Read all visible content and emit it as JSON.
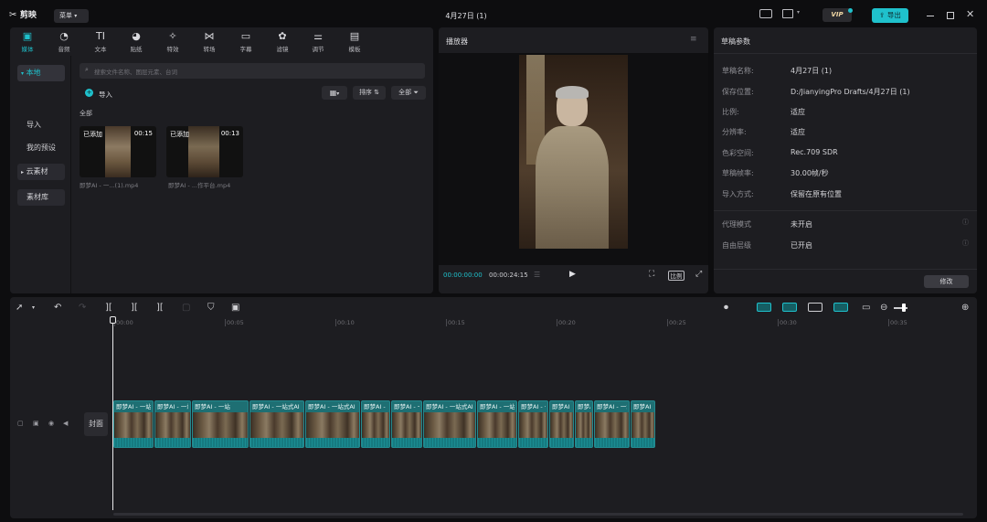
{
  "app": {
    "logo_text": "剪映",
    "menu_label": "菜单",
    "title": "4月27日 (1)",
    "vip_label": "VIP",
    "export_label": "导出"
  },
  "toolbar": {
    "items": [
      {
        "label": "媒体",
        "icon": "media-icon"
      },
      {
        "label": "音频",
        "icon": "audio-icon"
      },
      {
        "label": "文本",
        "icon": "text-icon"
      },
      {
        "label": "贴纸",
        "icon": "sticker-icon"
      },
      {
        "label": "特效",
        "icon": "effects-icon"
      },
      {
        "label": "转场",
        "icon": "transition-icon"
      },
      {
        "label": "字幕",
        "icon": "subtitle-icon"
      },
      {
        "label": "滤镜",
        "icon": "filter-icon"
      },
      {
        "label": "调节",
        "icon": "adjust-icon"
      },
      {
        "label": "模板",
        "icon": "template-icon"
      }
    ]
  },
  "sidebar": {
    "items": [
      {
        "label": "本地"
      },
      {
        "label": "导入"
      },
      {
        "label": "我的预设"
      },
      {
        "label": "云素材"
      },
      {
        "label": "素材库"
      }
    ]
  },
  "media": {
    "search_placeholder": "搜索文件名称、图层元素、台词",
    "import_label": "导入",
    "sort_label": "排序",
    "filter_label": "全部",
    "section_label": "全部",
    "clips": [
      {
        "badge": "已添加",
        "duration": "00:15",
        "name": "即梦AI - 一...(1).mp4"
      },
      {
        "badge": "已添加",
        "duration": "00:13",
        "name": "即梦AI - ...作平台.mp4"
      }
    ]
  },
  "player": {
    "title": "播放器",
    "current_time": "00:00:00:00",
    "total_time": "00:00:24:15",
    "ratio_label": "比例"
  },
  "draft": {
    "title": "草稿参数",
    "props": [
      {
        "label": "草稿名称:",
        "value": "4月27日 (1)"
      },
      {
        "label": "保存位置:",
        "value": "D:/JianyingPro Drafts/4月27日 (1)"
      },
      {
        "label": "比例:",
        "value": "适应"
      },
      {
        "label": "分辨率:",
        "value": "适应"
      },
      {
        "label": "色彩空间:",
        "value": "Rec.709 SDR"
      },
      {
        "label": "草稿帧率:",
        "value": "30.00帧/秒"
      },
      {
        "label": "导入方式:",
        "value": "保留在原有位置"
      }
    ],
    "props2": [
      {
        "label": "代理模式",
        "value": "未开启"
      },
      {
        "label": "自由层级",
        "value": "已开启"
      }
    ],
    "modify_label": "修改"
  },
  "timeline": {
    "ticks": [
      "00:00",
      "00:05",
      "00:10",
      "00:15",
      "00:20",
      "00:25",
      "00:30",
      "00:35"
    ],
    "cover_label": "封面",
    "clip_labels": [
      "即梦AI - 一站",
      "即梦AI - 一站",
      "即梦AI - 一站",
      "即梦AI - 一站式AI",
      "即梦AI - 一站式AI",
      "即梦AI - 一站",
      "即梦AI - 一站",
      "即梦AI - 一站式AI",
      "即梦AI - 一站",
      "即梦AI - 一站",
      "即梦AI",
      "即梦AI - 一站",
      "即梦AI - 一站",
      "即梦AI"
    ]
  },
  "colors": {
    "accent": "#1fc1cc",
    "panel": "#1d1d21",
    "background": "#0d0d0f",
    "clip": "#1e6f73"
  }
}
